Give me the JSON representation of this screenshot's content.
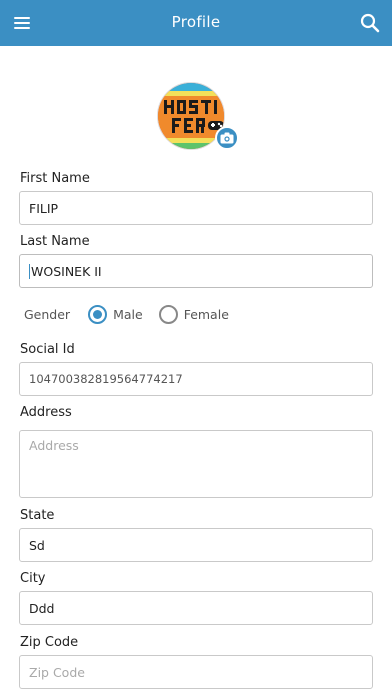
{
  "header": {
    "title": "Profile",
    "menu_icon": "hamburger-menu-icon",
    "search_icon": "search-icon"
  },
  "avatar": {
    "camera_icon": "camera-icon"
  },
  "form": {
    "first_name": {
      "label": "First Name",
      "value": "FILIP"
    },
    "last_name": {
      "label": "Last Name",
      "value": "WOSINEK II"
    },
    "gender": {
      "label": "Gender",
      "options": [
        "Male",
        "Female"
      ],
      "selected": "Male"
    },
    "social_id": {
      "label": "Social Id",
      "value": "104700382819564774217"
    },
    "address": {
      "label": "Address",
      "placeholder": "Address",
      "value": ""
    },
    "state": {
      "label": "State",
      "value": "Sd"
    },
    "city": {
      "label": "City",
      "value": "Ddd"
    },
    "zip_code": {
      "label": "Zip Code",
      "placeholder": "Zip Code",
      "value": ""
    }
  },
  "colors": {
    "accent": "#3b8fc3",
    "border": "#c9c9c9",
    "placeholder": "#a9a9a9"
  }
}
